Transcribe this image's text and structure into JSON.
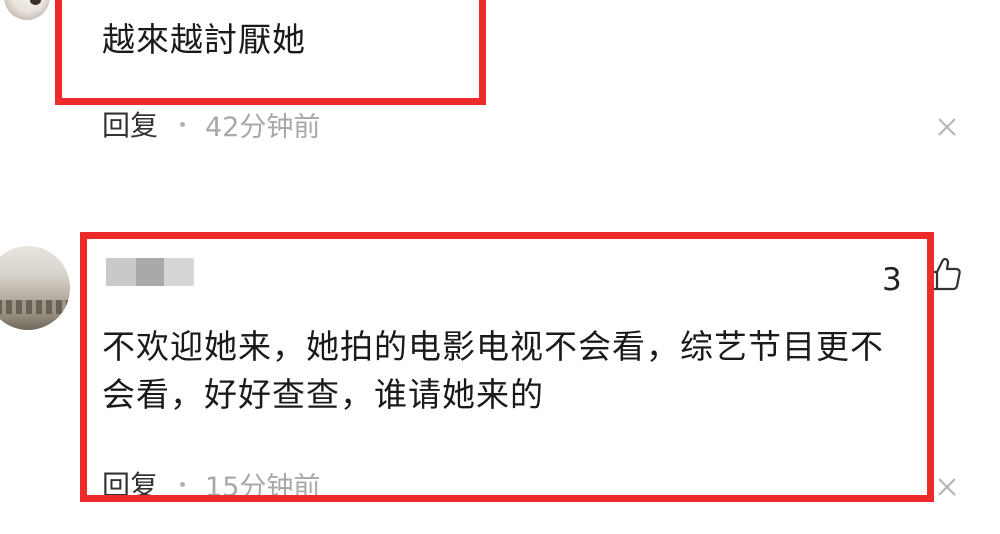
{
  "comments": [
    {
      "text": "越來越討厭她",
      "reply_label": "回复",
      "time": "42分钟前"
    },
    {
      "likes": "3",
      "text_lines": [
        "不欢迎她来，她拍的电影电视不会看，综艺节目更不",
        "会看，好好查查，谁请她来的"
      ],
      "reply_label": "回复",
      "time": "15分钟前"
    }
  ],
  "colors": {
    "highlight": "#ee2a2a",
    "text": "#1a1a1a",
    "muted": "#a8a8a8"
  },
  "icons": {
    "close": "close-icon",
    "like": "thumbs-up-icon",
    "separator": "dot-separator"
  }
}
